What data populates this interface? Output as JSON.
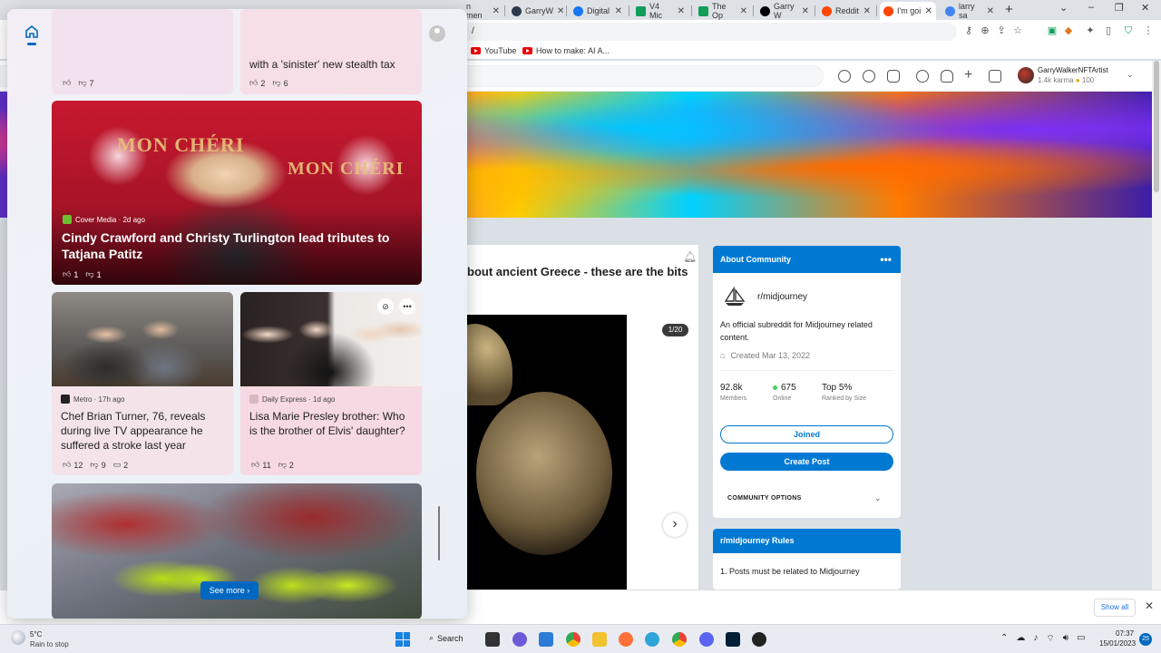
{
  "browser": {
    "tabs": [
      {
        "label": "n men",
        "color": "#888888"
      },
      {
        "label": "GarryW",
        "color": "#2b3a4a"
      },
      {
        "label": "Digital",
        "color": "#1877f2"
      },
      {
        "label": "V4 Mic",
        "color": "#0f9d58"
      },
      {
        "label": "The Op",
        "color": "#0f9d58"
      },
      {
        "label": "Garry W",
        "color": "#000000"
      },
      {
        "label": "Reddit",
        "color": "#ff4500"
      },
      {
        "label": "I'm goi",
        "color": "#ff4500"
      },
      {
        "label": "larry sa",
        "color": "#4285f4"
      }
    ],
    "url_fragment": "/",
    "bookmarks": [
      {
        "label": "YouTube"
      },
      {
        "label": "How to make: AI A..."
      }
    ]
  },
  "reddit": {
    "username": "GarryWalkerNFTArtist",
    "karma": "1.4k karma",
    "coins": "100",
    "post": {
      "title": "bout ancient Greece - these are the bits",
      "image_counter": "1/20"
    },
    "about": {
      "header": "About Community",
      "subreddit": "r/midjourney",
      "description": "An official subreddit for Midjourney related content.",
      "created": "Created Mar 13, 2022",
      "members_value": "92.8k",
      "members_label": "Members",
      "online_value": "675",
      "online_label": "Online",
      "rank_value": "Top 5%",
      "rank_label": "Ranked by Size",
      "joined_label": "Joined",
      "create_post_label": "Create Post",
      "community_options": "COMMUNITY OPTIONS"
    },
    "rules": {
      "header": "r/midjourney Rules",
      "rule_1": "1. Posts must be related to Midjourney"
    }
  },
  "download_bar": {
    "show_all": "Show all"
  },
  "widgets": {
    "cards": {
      "top_left": {
        "likes": "7"
      },
      "top_right": {
        "title": "with a 'sinister' new stealth tax",
        "likes": "2",
        "dislikes": "6"
      },
      "big": {
        "source": "Cover Media · 2d ago",
        "title": "Cindy Crawford and Christy Turlington lead tributes to Tatjana Patitz",
        "likes": "1",
        "dislikes": "1",
        "sign_text": "MON CHÉRI"
      },
      "mid_left": {
        "source": "Metro · 17h ago",
        "title": "Chef Brian Turner, 76, reveals during live TV appearance he suffered a stroke last year",
        "likes": "12",
        "dislikes": "9",
        "comments": "2"
      },
      "mid_right": {
        "source": "Daily Express · 1d ago",
        "title": "Lisa Marie Presley brother: Who is the brother of Elvis' daughter?",
        "likes": "11",
        "dislikes": "2"
      }
    },
    "see_more": "See more"
  },
  "taskbar": {
    "weather_temp": "5°C",
    "weather_desc": "Rain to stop",
    "search_label": "Search",
    "time": "07:37",
    "date": "15/01/2023",
    "notifications": "25"
  }
}
